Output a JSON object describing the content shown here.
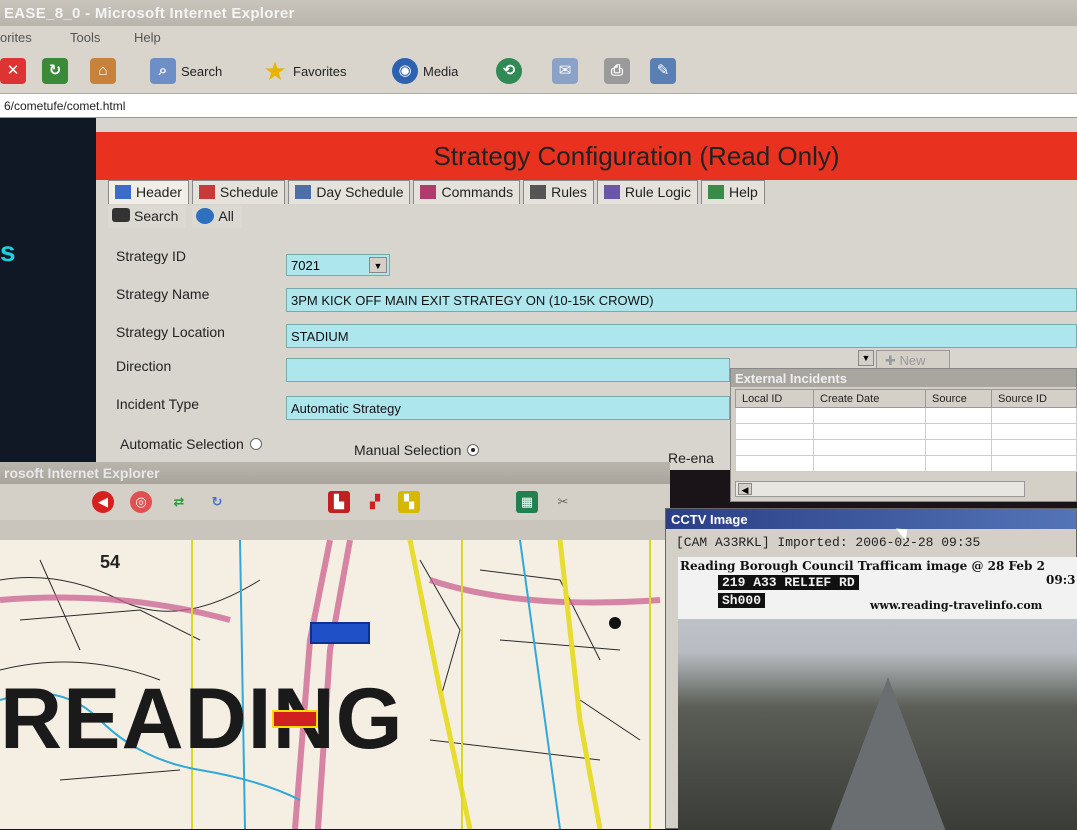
{
  "ie_top": {
    "title": "EASE_8_0 - Microsoft Internet Explorer",
    "menu": [
      "orites",
      "Tools",
      "Help"
    ],
    "toolbar": {
      "search": "Search",
      "favorites": "Favorites",
      "media": "Media"
    },
    "address": "6/cometufe/comet.html"
  },
  "page": {
    "banner": "Strategy Configuration (Read Only)",
    "left_letter": "s",
    "tabs": [
      {
        "label": "Header",
        "icon": "header-icon"
      },
      {
        "label": "Schedule",
        "icon": "calendar-icon"
      },
      {
        "label": "Day Schedule",
        "icon": "day-schedule-icon"
      },
      {
        "label": "Commands",
        "icon": "commands-icon"
      },
      {
        "label": "Rules",
        "icon": "rules-icon"
      },
      {
        "label": "Rule Logic",
        "icon": "rule-logic-icon"
      },
      {
        "label": "Help",
        "icon": "help-icon"
      }
    ],
    "subtabs": [
      {
        "label": "Search",
        "icon": "binoculars-icon"
      },
      {
        "label": "All",
        "icon": "globe-icon"
      }
    ],
    "form": {
      "strategy_id_label": "Strategy ID",
      "strategy_id_value": "7021",
      "strategy_name_label": "Strategy Name",
      "strategy_name_value": "3PM KICK OFF MAIN EXIT STRATEGY ON (10-15K CROWD)",
      "strategy_location_label": "Strategy Location",
      "strategy_location_value": "STADIUM",
      "direction_label": "Direction",
      "direction_value": "",
      "incident_type_label": "Incident Type",
      "incident_type_value": "Automatic Strategy",
      "new_button": "New",
      "automatic_selection": "Automatic Selection",
      "manual_selection": "Manual Selection",
      "re_enable": "Re-ena"
    },
    "external_incidents": {
      "title": "External Incidents",
      "columns": [
        "Local ID",
        "Create Date",
        "Source",
        "Source ID"
      ]
    }
  },
  "ie_bottom": {
    "title": "rosoft Internet Explorer",
    "map_label": "READING",
    "map_number": "54"
  },
  "cctv": {
    "title": "CCTV Image",
    "caption": "[CAM A33RKL] Imported: 2006-02-28 09:35",
    "image_line1": "Reading Borough Council Trafficam image @ 28 Feb 2",
    "image_time": "09:3",
    "overlay_road": "219 A33 RELIEF RD",
    "overlay_code": "Sh000",
    "url": "www.reading-travelinfo.com"
  },
  "colors": {
    "banner": "#e8321f",
    "field": "#aee6ee",
    "cctv_title": "#2a3f86"
  }
}
